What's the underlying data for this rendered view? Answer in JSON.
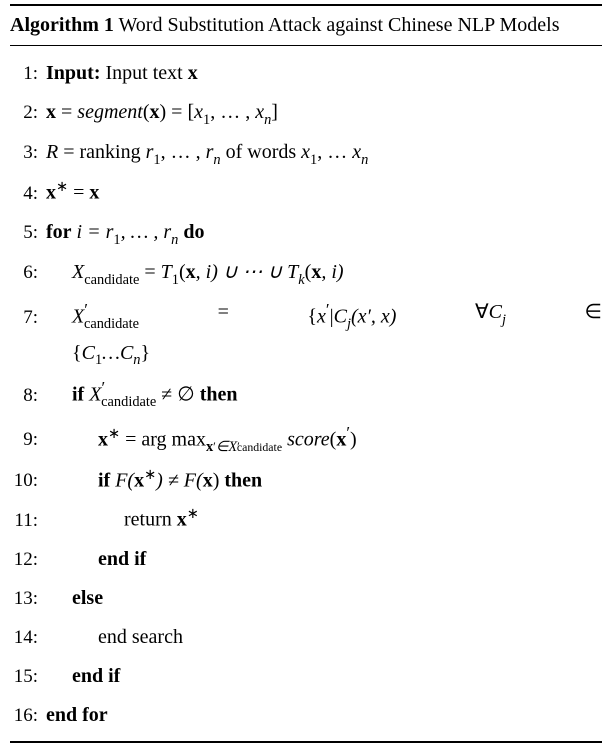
{
  "algo": {
    "label": "Algorithm 1",
    "title_rest": " Word Substitution Attack against Chinese NLP Models",
    "lines": {
      "l1_input": "Input:",
      "l1_rest": " Input text ",
      "l1_x": "x",
      "l2_a": "x",
      "l2_eq": " = ",
      "l2_seg": "segment",
      "l2_paren_open": "(",
      "l2_xarg": "x",
      "l2_paren_close": ") = [",
      "l2_x1": "x",
      "l2_sub1": "1",
      "l2_dots": ", … , ",
      "l2_xn": "x",
      "l2_subn": "n",
      "l2_close": "]",
      "l3_R": "R",
      "l3_eq": " = ranking ",
      "l3_r1": "r",
      "l3_sub1": "1",
      "l3_dots": ", … , ",
      "l3_rn": "r",
      "l3_subn": "n",
      "l3_of": " of words ",
      "l3_x1": "x",
      "l3_xsub1": "1",
      "l3_dots2": ", … ",
      "l3_xn": "x",
      "l3_xsubn": "n",
      "l4_xs": "x",
      "l4_star": "∗",
      "l4_eq": " = ",
      "l4_xr": "x",
      "l5_for": "for",
      "l5_i": " i = r",
      "l5_s1": "1",
      "l5_dots": ", … , r",
      "l5_sn": "n",
      "l5_sp": " ",
      "l5_do": "do",
      "l6_X": "X",
      "l6_cand": "candidate",
      "l6_eq": " = ",
      "l6_T1": "T",
      "l6_s1": "1",
      "l6_p1": "(",
      "l6_x1": "x",
      "l6_c1": ", i) ∪ ⋯ ∪ ",
      "l6_Tk": "T",
      "l6_sk": "k",
      "l6_p2": "(",
      "l6_x2": "x",
      "l6_c2": ", i)",
      "l7_Xp": "X",
      "l7_prime": "′",
      "l7_cand": "candidate",
      "l7_eq": "=",
      "l7_set_open": "{",
      "l7_xp": "x",
      "l7_xprime": "′",
      "l7_bar": "|",
      "l7_Cj": "C",
      "l7_j": "j",
      "l7_args": "(x′, x)",
      "l7_forall": "∀",
      "l7_Cj2": "C",
      "l7_j2": "j",
      "l7_in": "∈",
      "l7b_open": "{",
      "l7b_C1": "C",
      "l7b_1": "1",
      "l7b_dots": "…",
      "l7b_Cn": "C",
      "l7b_n": "n",
      "l7b_close": "}",
      "l8_if": "if",
      "l8_X": " X",
      "l8_prime": "′",
      "l8_cand": "candidate",
      "l8_neq": " ≠ ∅ ",
      "l8_then": "then",
      "l9_xs": "x",
      "l9_star": "∗",
      "l9_eq": " = arg max",
      "l9_sub_x": "x",
      "l9_sub_prime": "′",
      "l9_sub_in": "∈X",
      "l9_sub_Xp": "′",
      "l9_sub_cand": "candidate",
      "l9_sp": " ",
      "l9_score": "score",
      "l9_po": "(",
      "l9_xarg": "x",
      "l9_argprime": "′",
      "l9_pc": ")",
      "l10_if": "if",
      "l10_F1": " F(",
      "l10_xs": "x",
      "l10_star": "∗",
      "l10_neq": ") ≠ F(",
      "l10_x": "x",
      "l10_close": ") ",
      "l10_then": "then",
      "l11_ret": "return ",
      "l11_xs": "x",
      "l11_star": "∗",
      "l12_endif": "end if",
      "l13_else": "else",
      "l14_end": "end search",
      "l15_endif": "end if",
      "l16_endfor": "end for"
    },
    "nums": {
      "n1": "1:",
      "n2": "2:",
      "n3": "3:",
      "n4": "4:",
      "n5": "5:",
      "n6": "6:",
      "n7": "7:",
      "n8": "8:",
      "n9": "9:",
      "n10": "10:",
      "n11": "11:",
      "n12": "12:",
      "n13": "13:",
      "n14": "14:",
      "n15": "15:",
      "n16": "16:"
    }
  }
}
